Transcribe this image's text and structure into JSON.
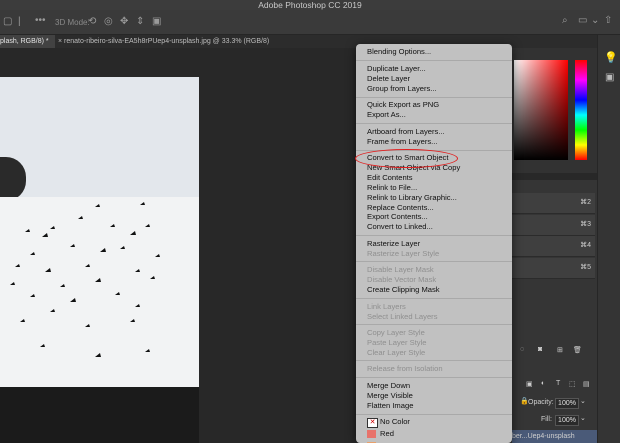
{
  "app": {
    "title": "Adobe Photoshop CC 2019"
  },
  "options_bar": {
    "mode_label": "3D Mode:"
  },
  "tabs": [
    {
      "label": "plash, RGB/8) *"
    },
    {
      "label": "renato-ribeiro-silva-EA5h8rPUep4-unsplash.jpg @ 33.3% (RGB/8)"
    }
  ],
  "context_menu": {
    "items": [
      {
        "label": "Blending Options...",
        "enabled": true
      },
      {
        "label": "Duplicate Layer...",
        "enabled": true
      },
      {
        "label": "Delete Layer",
        "enabled": true
      },
      {
        "label": "Group from Layers...",
        "enabled": true
      },
      {
        "label": "Quick Export as PNG",
        "enabled": true
      },
      {
        "label": "Export As...",
        "enabled": true
      },
      {
        "label": "Artboard from Layers...",
        "enabled": true
      },
      {
        "label": "Frame from Layers...",
        "enabled": true
      },
      {
        "label": "Convert to Smart Object",
        "enabled": true,
        "highlighted": true
      },
      {
        "label": "New Smart Object via Copy",
        "enabled": true
      },
      {
        "label": "Edit Contents",
        "enabled": true
      },
      {
        "label": "Relink to File...",
        "enabled": true
      },
      {
        "label": "Relink to Library Graphic...",
        "enabled": true
      },
      {
        "label": "Replace Contents...",
        "enabled": true
      },
      {
        "label": "Export Contents...",
        "enabled": true
      },
      {
        "label": "Convert to Linked...",
        "enabled": true
      },
      {
        "label": "Rasterize Layer",
        "enabled": true
      },
      {
        "label": "Rasterize Layer Style",
        "enabled": false
      },
      {
        "label": "Disable Layer Mask",
        "enabled": false
      },
      {
        "label": "Disable Vector Mask",
        "enabled": false
      },
      {
        "label": "Create Clipping Mask",
        "enabled": true
      },
      {
        "label": "Link Layers",
        "enabled": false
      },
      {
        "label": "Select Linked Layers",
        "enabled": false
      },
      {
        "label": "Copy Layer Style",
        "enabled": false
      },
      {
        "label": "Paste Layer Style",
        "enabled": false
      },
      {
        "label": "Clear Layer Style",
        "enabled": false
      },
      {
        "label": "Release from Isolation",
        "enabled": false
      },
      {
        "label": "Merge Down",
        "enabled": true
      },
      {
        "label": "Merge Visible",
        "enabled": true
      },
      {
        "label": "Flatten Image",
        "enabled": true
      },
      {
        "label": "No Color",
        "enabled": true,
        "swatch": "#ffffff"
      },
      {
        "label": "Red",
        "enabled": true,
        "swatch": "#e8736b"
      }
    ]
  },
  "channels_panel": {
    "shortcuts": [
      "⌘2",
      "⌘3",
      "⌘4",
      "⌘5"
    ]
  },
  "layers_panel": {
    "opacity_label": "Opacity:",
    "opacity_value": "100%",
    "fill_label": "Fill:",
    "fill_value": "100%",
    "layer_name_fragment": "ber...Uep4-unsplash"
  },
  "colors": {
    "highlight_ellipse": "#e02020",
    "menu_bg": "#cdcdcd"
  }
}
